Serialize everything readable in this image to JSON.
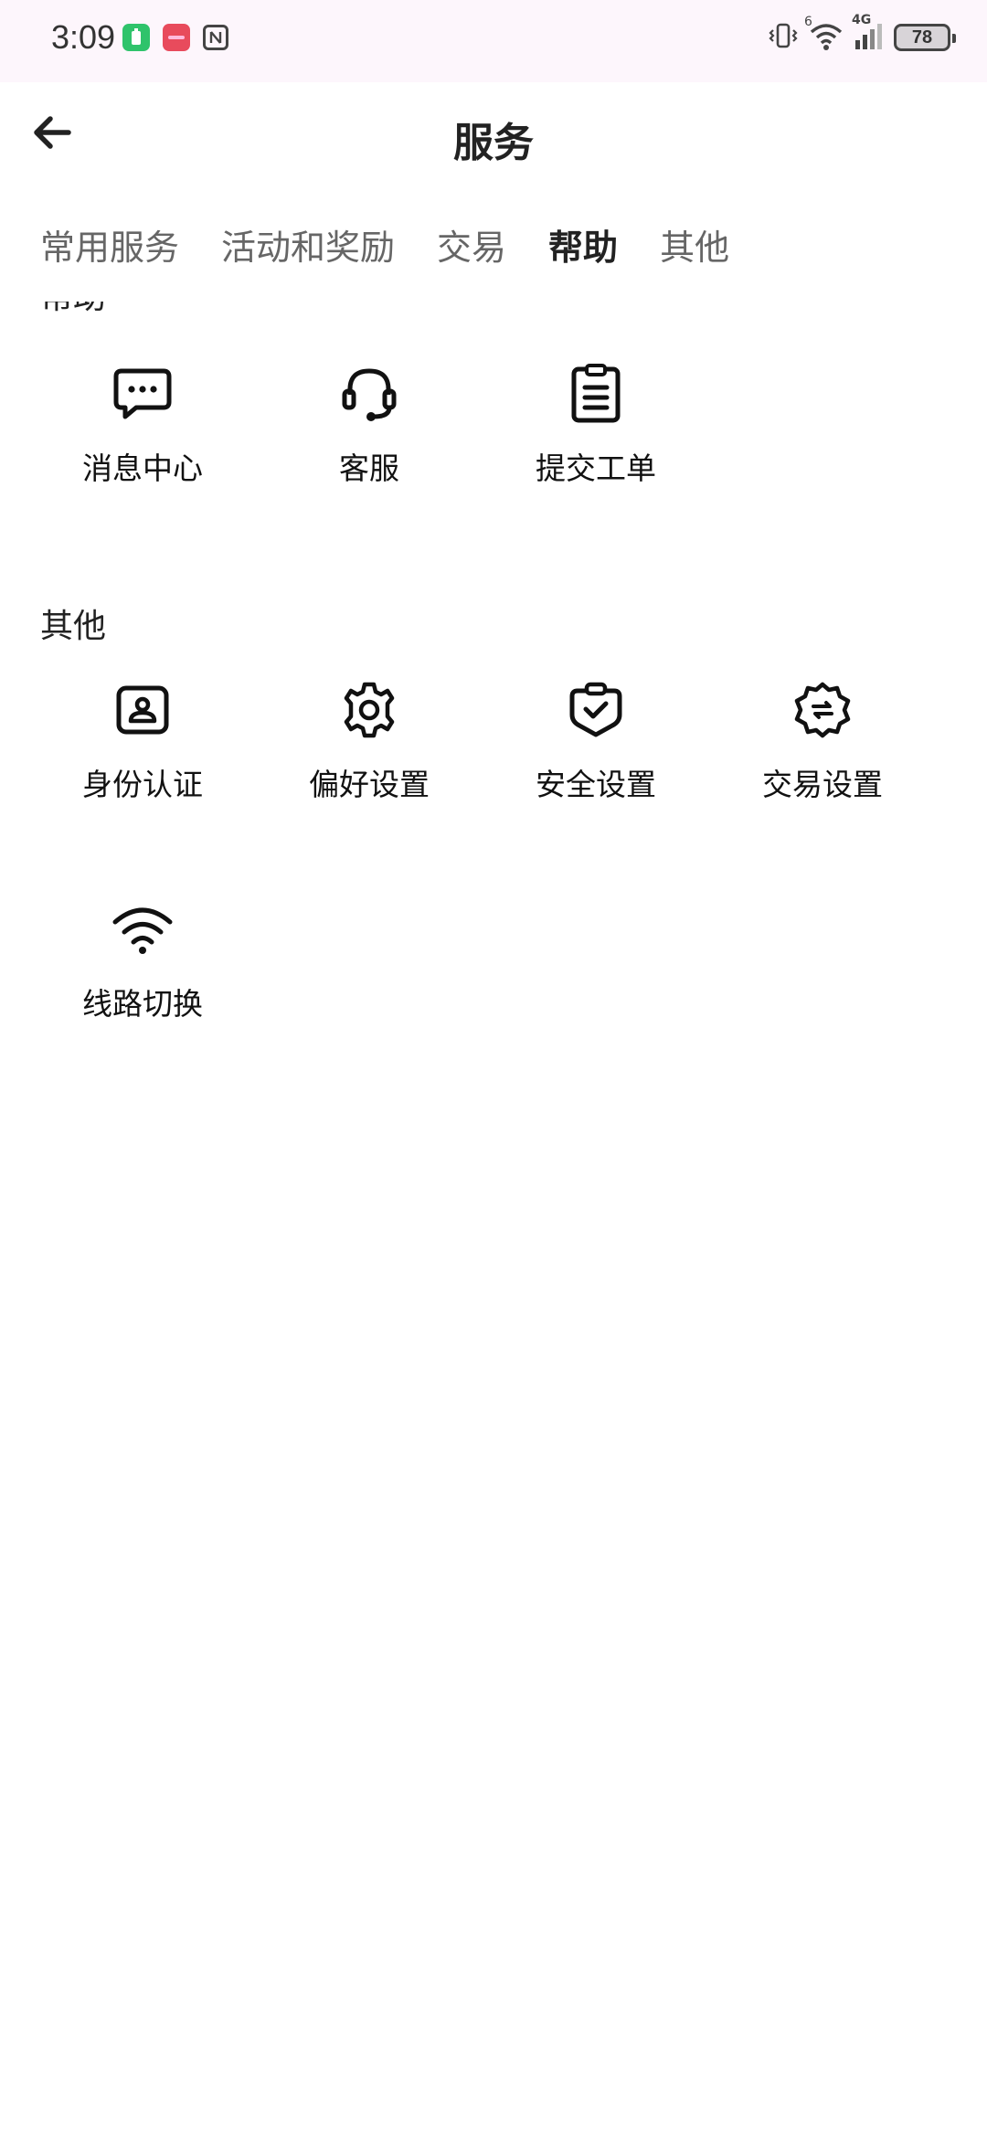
{
  "status_bar": {
    "time": "3:09",
    "network_label": "4G",
    "wifi_badge": "6",
    "battery": "78",
    "app_badge_color": "#2fc36b",
    "app_badge2_color": "#e84b5c"
  },
  "header": {
    "title": "服务"
  },
  "tabs": [
    {
      "label": "常用服务",
      "active": false
    },
    {
      "label": "活动和奖励",
      "active": false
    },
    {
      "label": "交易",
      "active": false
    },
    {
      "label": "帮助",
      "active": true
    },
    {
      "label": "其他",
      "active": false
    }
  ],
  "sections": {
    "help": {
      "title": "帮助",
      "items": [
        {
          "label": "消息中心",
          "icon": "message-icon"
        },
        {
          "label": "客服",
          "icon": "headset-icon"
        },
        {
          "label": "提交工单",
          "icon": "clipboard-icon"
        }
      ]
    },
    "other": {
      "title": "其他",
      "items": [
        {
          "label": "身份认证",
          "icon": "id-card-icon"
        },
        {
          "label": "偏好设置",
          "icon": "gear-icon"
        },
        {
          "label": "安全设置",
          "icon": "shield-check-icon"
        },
        {
          "label": "交易设置",
          "icon": "trade-settings-icon"
        },
        {
          "label": "线路切换",
          "icon": "wifi-icon"
        }
      ]
    }
  },
  "colors": {
    "accent_text": "#222222",
    "inactive_tab": "#666666",
    "status_bar_bg": "#fdf6fc"
  }
}
